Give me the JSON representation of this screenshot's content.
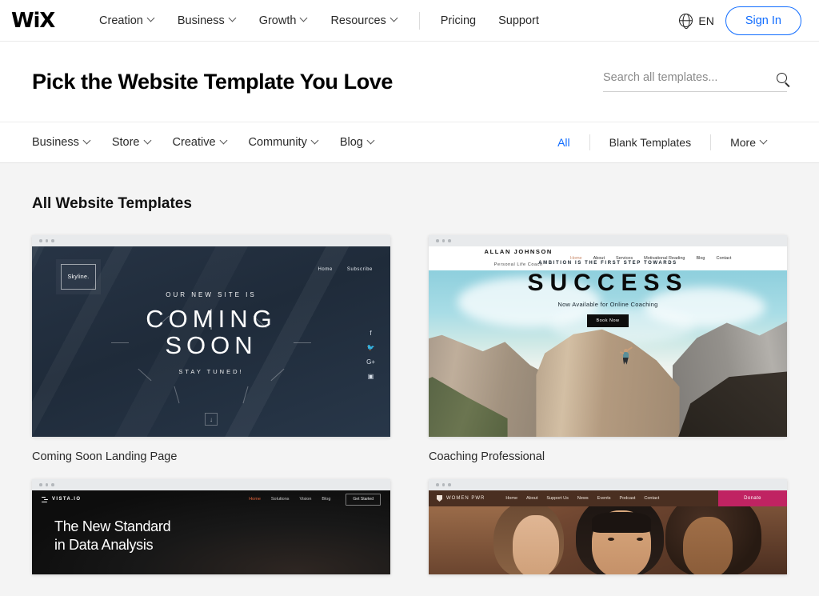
{
  "header": {
    "logo": "WiX",
    "nav": [
      {
        "label": "Creation",
        "has_chevron": true
      },
      {
        "label": "Business",
        "has_chevron": true
      },
      {
        "label": "Growth",
        "has_chevron": true
      },
      {
        "label": "Resources",
        "has_chevron": true
      }
    ],
    "nav_plain": [
      {
        "label": "Pricing"
      },
      {
        "label": "Support"
      }
    ],
    "language": "EN",
    "language_icon": "globe-icon",
    "sign_in": "Sign In",
    "accent_color": "#116dff"
  },
  "titlebar": {
    "title": "Pick the Website Template You Love",
    "search_placeholder": "Search all templates...",
    "search_value": "",
    "search_icon": "search-icon"
  },
  "categories": {
    "left": [
      {
        "label": "Business",
        "has_chevron": true
      },
      {
        "label": "Store",
        "has_chevron": true
      },
      {
        "label": "Creative",
        "has_chevron": true
      },
      {
        "label": "Community",
        "has_chevron": true
      },
      {
        "label": "Blog",
        "has_chevron": true
      }
    ],
    "right": [
      {
        "label": "All",
        "active": true,
        "has_chevron": false
      },
      {
        "label": "Blank Templates",
        "active": false,
        "has_chevron": false
      },
      {
        "label": "More",
        "active": false,
        "has_chevron": true
      }
    ]
  },
  "gallery": {
    "section_title": "All Website Templates",
    "cards": [
      {
        "label": "Coming Soon Landing Page",
        "preview": {
          "logo": "Skyline.",
          "nav": [
            "Home",
            "Subscribe"
          ],
          "kicker": "OUR NEW SITE IS",
          "heading_line1": "COMING",
          "heading_line2": "SOON",
          "subtext": "STAY TUNED!",
          "social": [
            "f",
            "twitter",
            "G+",
            "instagram"
          ],
          "scroll_indicator": "↓"
        }
      },
      {
        "label": "Coaching Professional",
        "preview": {
          "brand": "ALLAN JOHNSON",
          "brand_sub": "Personal Life Coach",
          "nav": [
            "Home",
            "About",
            "Services",
            "Motivational Reading",
            "Blog",
            "Contact"
          ],
          "kicker": "AMBITION IS THE FIRST STEP TOWARDS",
          "heading": "SUCCESS",
          "subtext": "Now Available for Online Coaching",
          "button": "Book Now"
        }
      },
      {
        "label": "",
        "preview": {
          "logo": "VISTA.IO",
          "nav": [
            "Home",
            "Solutions",
            "Vision",
            "Blog"
          ],
          "cta": "Get Started",
          "heading_line1": "The New Standard",
          "heading_line2": "in Data Analysis",
          "active_nav_color": "#e0633a"
        }
      },
      {
        "label": "",
        "preview": {
          "logo": "WOMEN PWR",
          "nav": [
            "Home",
            "About",
            "Support Us",
            "News",
            "Events",
            "Podcast",
            "Contact"
          ],
          "donate": "Donate",
          "donate_color": "#c02362"
        }
      }
    ]
  }
}
